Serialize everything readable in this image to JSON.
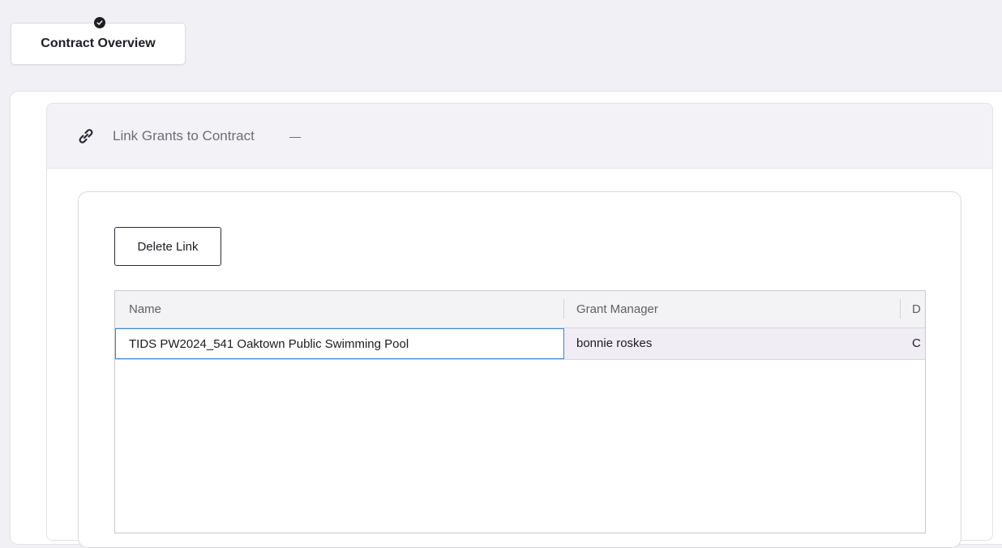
{
  "step_tab": {
    "label": "Contract Overview",
    "status_icon": "check-circle-icon"
  },
  "section": {
    "icon": "link-icon",
    "title": "Link Grants to Contract",
    "collapse_icon": "minus-icon"
  },
  "toolbar": {
    "delete_label": "Delete Link"
  },
  "grid": {
    "columns": [
      "Name",
      "Grant Manager",
      "D"
    ],
    "rows": [
      {
        "name": "TIDS PW2024_541 Oaktown Public Swimming Pool",
        "grant_manager": "bonnie roskes",
        "third": "C"
      }
    ]
  },
  "colors": {
    "accent_focus": "#3a86d6",
    "row_selected": "#f1edf5",
    "page_bg": "#f1f1f5"
  }
}
